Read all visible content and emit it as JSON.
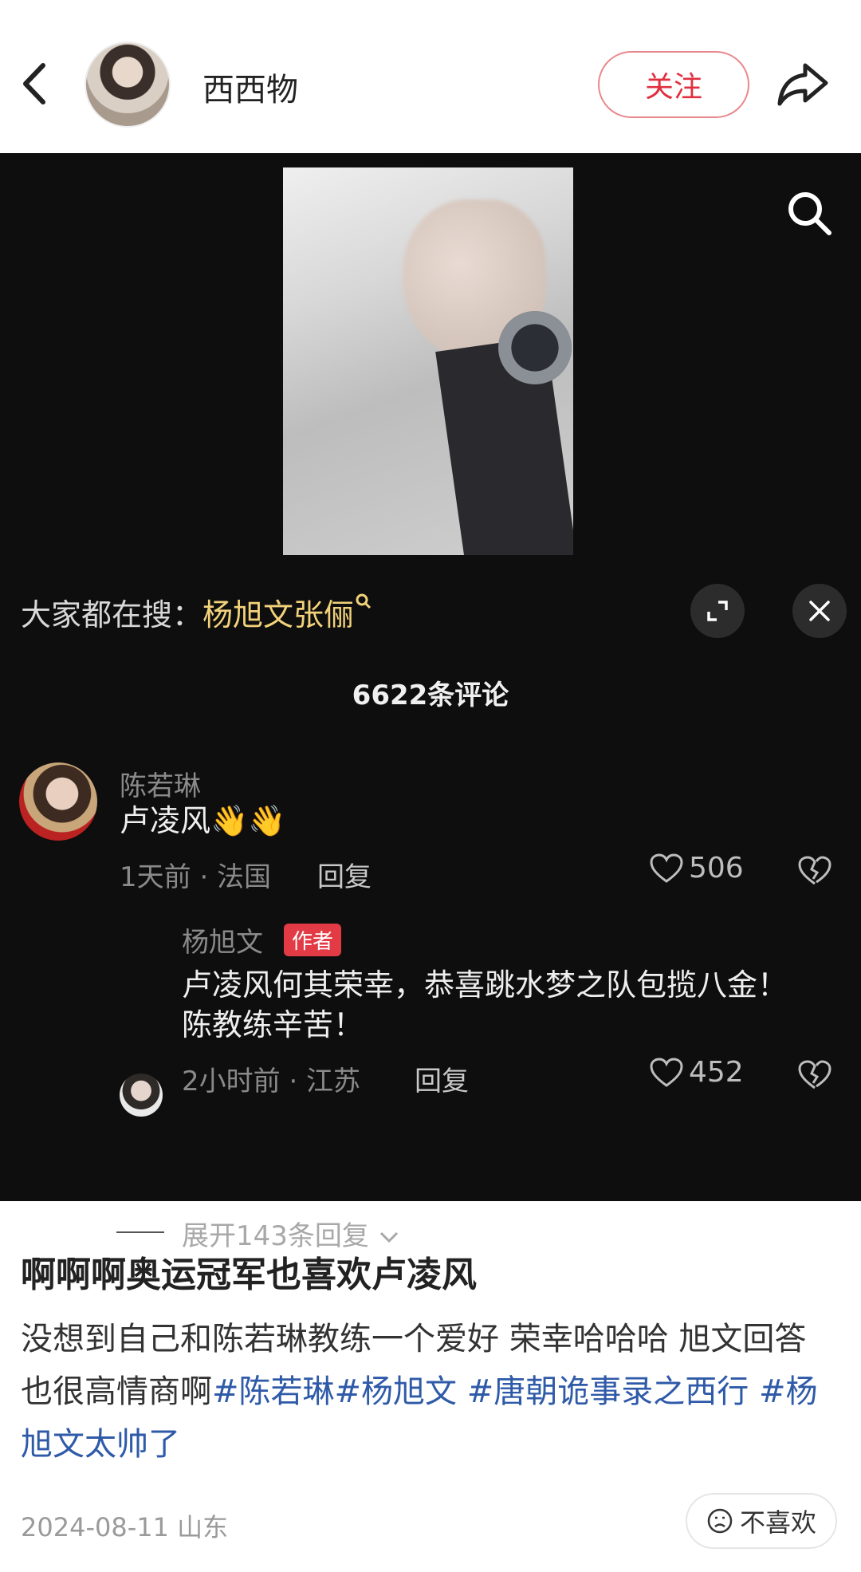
{
  "header": {
    "author_name": "西西物",
    "follow_label": "关注"
  },
  "screenshot": {
    "search_prefix": "大家都在搜：",
    "search_keyword": "杨旭文张俪",
    "comment_count": "6622条评论",
    "comments": [
      {
        "name": "陈若琳",
        "text": "卢凌风👋👋",
        "meta": "1天前 · 法国",
        "reply_label": "回复",
        "likes": "506"
      },
      {
        "name": "杨旭文",
        "badge": "作者",
        "text": "卢凌风何其荣幸，恭喜跳水梦之队包揽八金！陈教练辛苦！",
        "meta": "2小时前 · 江苏",
        "reply_label": "回复",
        "likes": "452"
      }
    ],
    "expand_replies": "展开143条回复"
  },
  "post": {
    "title": "啊啊啊奥运冠军也喜欢卢凌风",
    "body_text": "没想到自己和陈若琳教练一个爱好 荣幸哈哈哈 旭文回答也很高情商啊",
    "tags": [
      "#陈若琳",
      "#杨旭文 ",
      "#唐朝诡事录之西行 ",
      "#杨旭文太帅了"
    ],
    "meta": "2024-08-11 山东",
    "dislike_label": "不喜欢"
  },
  "colors": {
    "accent_red": "#e03040",
    "tag_blue": "#2e5aa8",
    "keyword_yellow": "#f2d27a"
  }
}
